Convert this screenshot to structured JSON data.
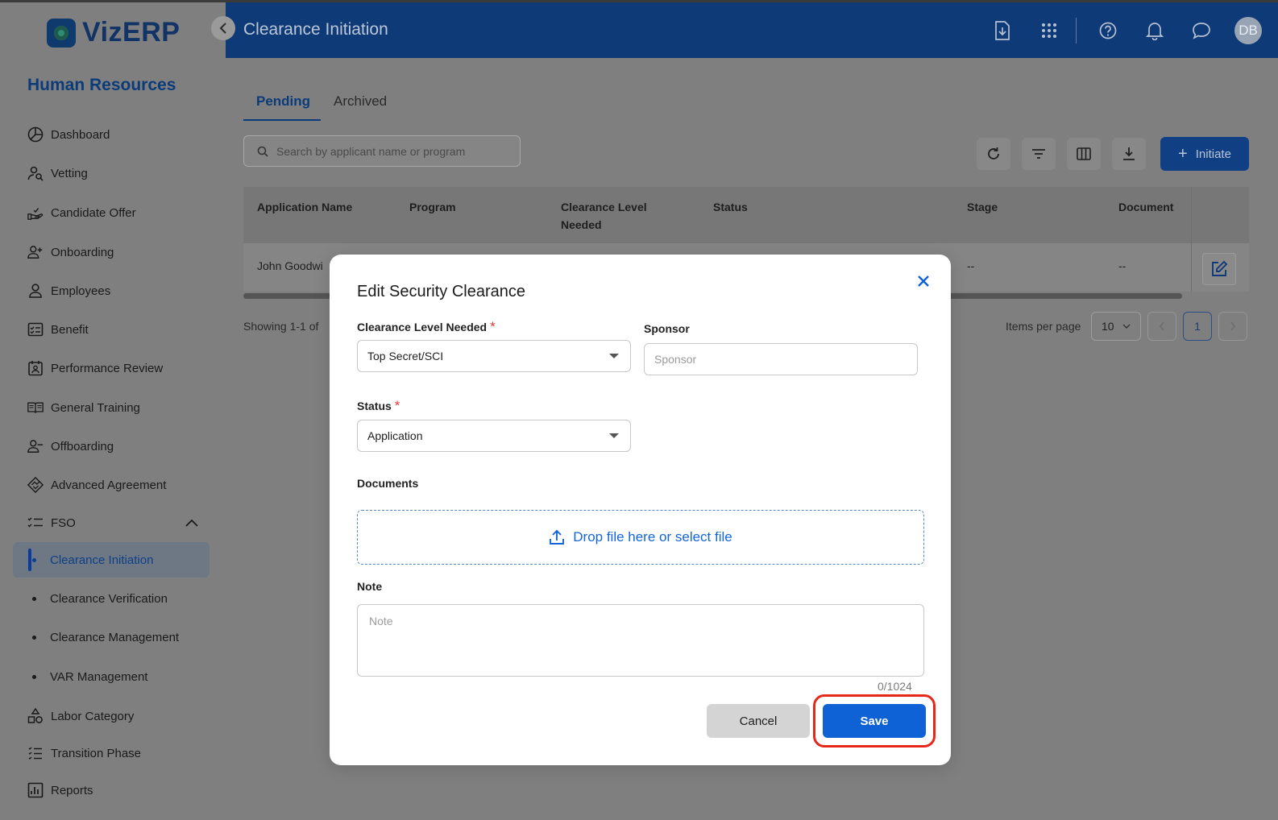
{
  "app": {
    "logo_text": "VizERP",
    "module_title": "Human Resources",
    "collapse_symbol": "‹",
    "page_title": "Clearance Initiation"
  },
  "header": {
    "icons": [
      "download-file-icon",
      "apps-grid-icon",
      "help-icon",
      "bell-icon",
      "chat-icon"
    ],
    "avatar_initials": "DB"
  },
  "sidebar": {
    "items": [
      {
        "label": "Dashboard",
        "icon": "pie-chart-icon"
      },
      {
        "label": "Vetting",
        "icon": "person-search-icon"
      },
      {
        "label": "Candidate Offer",
        "icon": "hand-offer-icon"
      },
      {
        "label": "Onboarding",
        "icon": "person-add-icon"
      },
      {
        "label": "Employees",
        "icon": "person-icon"
      },
      {
        "label": "Benefit",
        "icon": "checklist-card-icon"
      },
      {
        "label": "Performance Review",
        "icon": "calendar-person-icon"
      },
      {
        "label": "General Training",
        "icon": "book-icon"
      },
      {
        "label": "Offboarding",
        "icon": "person-remove-icon"
      },
      {
        "label": "Advanced Agreement",
        "icon": "handshake-icon"
      },
      {
        "label": "FSO",
        "icon": "checklist-icon"
      }
    ],
    "fso_sub": [
      {
        "label": "Clearance Initiation",
        "active": true
      },
      {
        "label": "Clearance Verification",
        "active": false
      },
      {
        "label": "Clearance Management",
        "active": false
      },
      {
        "label": "VAR Management",
        "active": false
      }
    ],
    "bottom_items": [
      {
        "label": "Labor Category",
        "icon": "shapes-icon"
      },
      {
        "label": "Transition Phase",
        "icon": "list-numbered-icon"
      },
      {
        "label": "Reports",
        "icon": "report-chart-icon"
      }
    ]
  },
  "tabs": {
    "pending": "Pending",
    "archived": "Archived"
  },
  "search": {
    "placeholder": "Search by applicant name or program"
  },
  "toolbar": {
    "initiate_label": "Initiate"
  },
  "table": {
    "headers": [
      "Application Name",
      "Program",
      "Clearance Level",
      "Needed",
      "Status",
      "Stage",
      "Document"
    ],
    "row": {
      "application_name": "John Goodwi",
      "stage": "--",
      "document": "--"
    }
  },
  "pagination": {
    "showing": "Showing 1-1 of",
    "items_per_page_label": "Items per page",
    "items_per_page": "10",
    "current_page": "1"
  },
  "modal": {
    "title": "Edit Security Clearance",
    "clearance_label": "Clearance Level Needed",
    "clearance_value": "Top Secret/SCI",
    "sponsor_label": "Sponsor",
    "sponsor_placeholder": "Sponsor",
    "status_label": "Status",
    "status_value": "Application",
    "documents_label": "Documents",
    "dropzone_text": "Drop file here or select file",
    "note_label": "Note",
    "note_placeholder": "Note",
    "char_counter": "0/1024",
    "cancel_label": "Cancel",
    "save_label": "Save",
    "required_mark": "*"
  },
  "colors": {
    "header_bg": "#0e3a78",
    "primary_button": "#0e62d6",
    "highlight": "#e8271b",
    "required": "#e53935"
  }
}
